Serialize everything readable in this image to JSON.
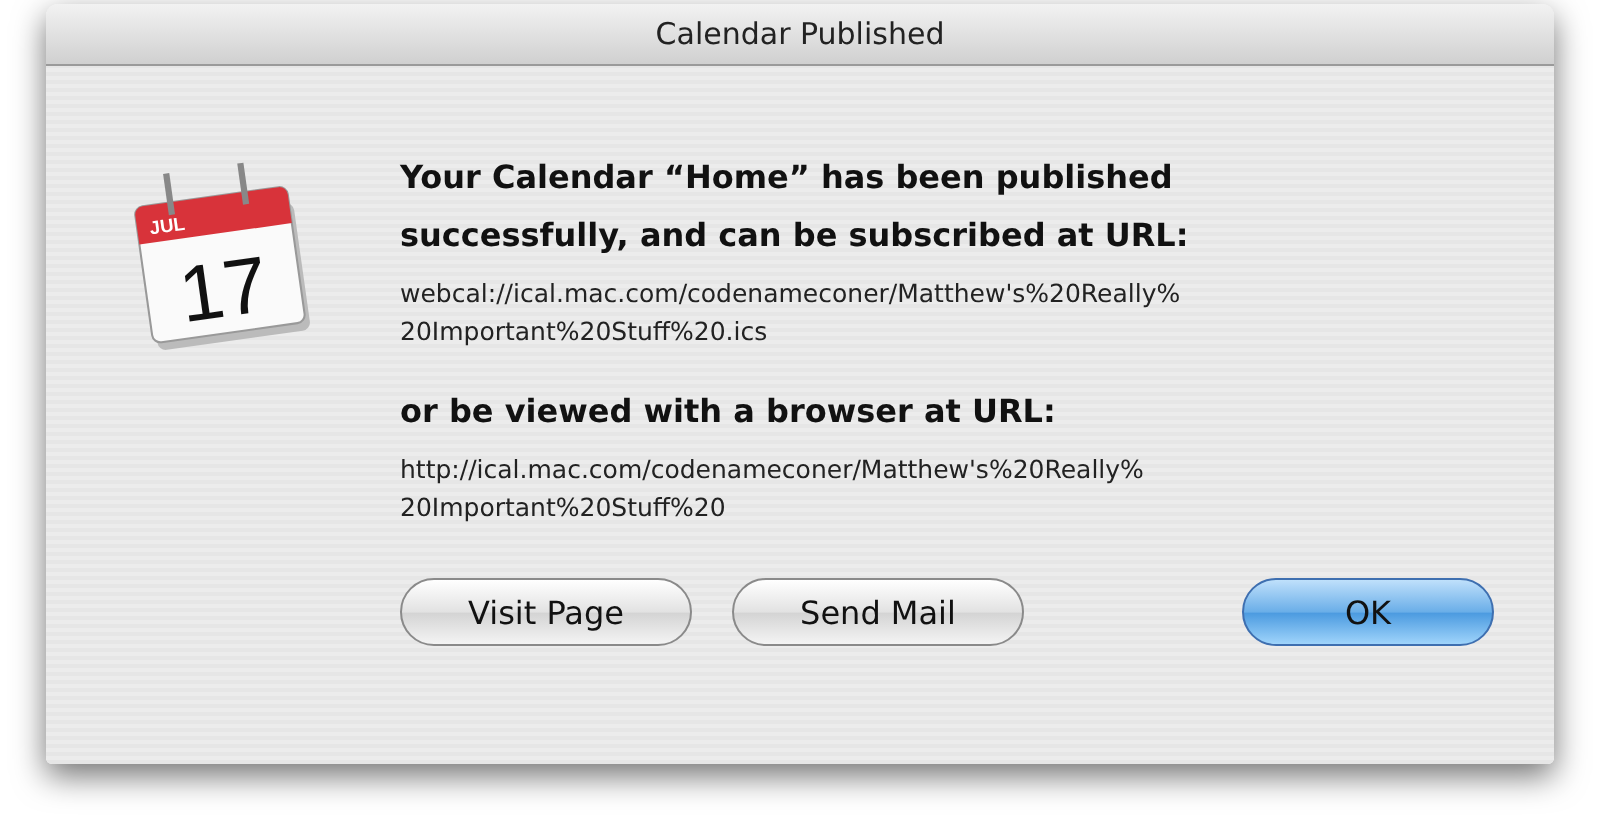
{
  "window": {
    "title": "Calendar Published"
  },
  "calendar_icon": {
    "month": "JUL",
    "day": "17"
  },
  "message": [
    {
      "kind": "heading",
      "text": "Your Calendar “Home” has been published\nsuccessfully, and can be subscribed at URL:"
    },
    {
      "kind": "url",
      "text": "webcal://ical.mac.com/codenameconer/Matthew's%20Really%\n20Important%20Stuff%20.ics"
    },
    {
      "kind": "heading",
      "text": "or be viewed with a browser at URL:"
    },
    {
      "kind": "url",
      "text": "http://ical.mac.com/codenameconer/Matthew's%20Really%\n20Important%20Stuff%20"
    }
  ],
  "buttons": [
    {
      "label": "Visit Page",
      "default": false
    },
    {
      "label": "Send Mail",
      "default": false
    },
    {
      "label": "OK",
      "default": true
    }
  ]
}
